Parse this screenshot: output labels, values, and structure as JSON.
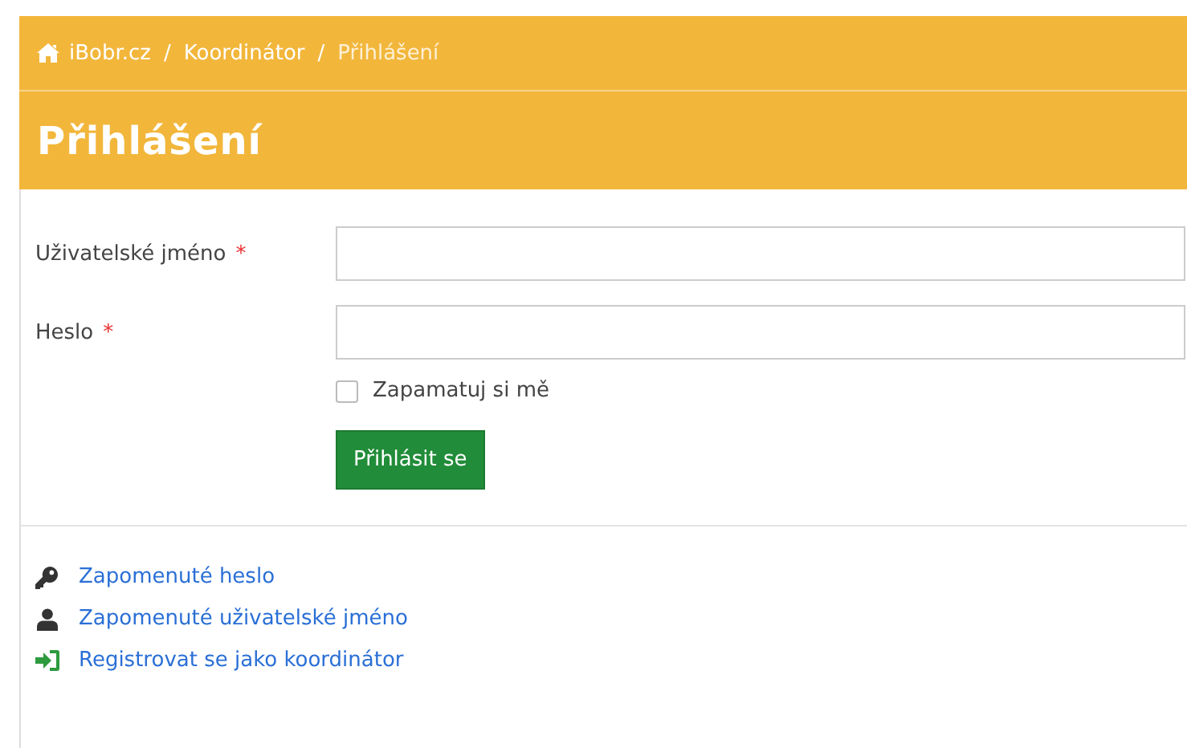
{
  "breadcrumb": [
    {
      "label": "iBobr.cz",
      "kind": "home"
    },
    {
      "label": "Koordinátor",
      "kind": "link",
      "separator": "/"
    },
    {
      "label": "Přihlášení",
      "kind": "current",
      "separator": "/"
    }
  ],
  "page_title": "Přihlášení",
  "form": {
    "fields": [
      {
        "label": "Uživatelské jméno",
        "required_mark": "*"
      },
      {
        "label": "Heslo",
        "required_mark": "*"
      }
    ],
    "remember": {
      "label": "Zapamatuj si mě",
      "checked": false
    },
    "submit": "Přihlásit se"
  },
  "links": [
    {
      "label": "Zapomenuté heslo",
      "kind": "key"
    },
    {
      "label": "Zapomenuté uživatelské jméno",
      "kind": "user"
    },
    {
      "label": "Registrovat se jako koordinátor",
      "kind": "sign-in"
    }
  ]
}
